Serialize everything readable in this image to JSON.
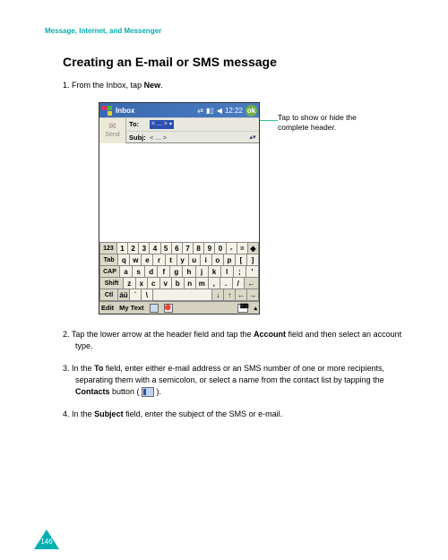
{
  "section_header": "Message, Internet, and Messenger",
  "title": "Creating an E-mail or SMS message",
  "steps": [
    {
      "num": "1.",
      "pre": "From the Inbox, tap ",
      "bold": "New",
      "post": "."
    },
    {
      "num": "2.",
      "pre": "Tap the lower arrow at the header field and tap the ",
      "bold": "Account",
      "post": " field and then select an account type."
    },
    {
      "num": "3.",
      "pre": "In the ",
      "bold": "To",
      "mid": " field, enter either e-mail address or an SMS number of one or more recipients, separating them with a semicolon, or select a name from the contact list by tapping the ",
      "bold2": "Contacts",
      "post": " button ( ",
      "tail": " )."
    },
    {
      "num": "4.",
      "pre": "In the ",
      "bold": "Subject",
      "post": " field, enter the subject of the SMS or e-mail."
    }
  ],
  "callout": "Tap to show or hide the complete header.",
  "device": {
    "title": "Inbox",
    "time": "12:22",
    "ok": "ok",
    "send": "Send",
    "to_label": "To:",
    "to_chip": "< ... >",
    "subj_label": "Subj:",
    "subj_value": "< ... >",
    "kbd": {
      "r1": [
        "123",
        "1",
        "2",
        "3",
        "4",
        "5",
        "6",
        "7",
        "8",
        "9",
        "0",
        "-",
        "=",
        "◆"
      ],
      "r2": [
        "Tab",
        "q",
        "w",
        "e",
        "r",
        "t",
        "y",
        "u",
        "i",
        "o",
        "p",
        "[",
        "]"
      ],
      "r3": [
        "CAP",
        "a",
        "s",
        "d",
        "f",
        "g",
        "h",
        "j",
        "k",
        "l",
        ";",
        "'"
      ],
      "r4": [
        "Shift",
        "z",
        "x",
        "c",
        "v",
        "b",
        "n",
        "m",
        ",",
        ".",
        "/",
        "←"
      ],
      "r5": [
        "Ctl",
        "áü",
        "`",
        "\\",
        " ",
        "↓",
        "↑",
        "←",
        "→"
      ]
    },
    "bottombar": {
      "edit": "Edit",
      "mytext": "My Text"
    }
  },
  "page_number": "146"
}
